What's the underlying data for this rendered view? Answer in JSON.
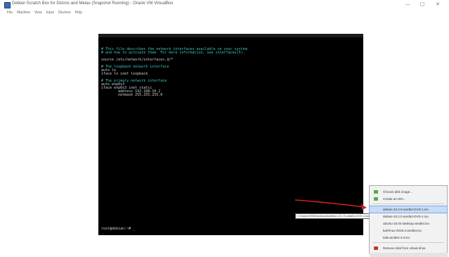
{
  "window": {
    "title": "Debian Scratch Box for Distros and Metas (Snapshot Running) - Oracle VM VirtualBox",
    "minimize": "—",
    "maximize": "□",
    "close": "✕"
  },
  "menu": [
    "File",
    "Machine",
    "View",
    "Input",
    "Devices",
    "Help"
  ],
  "vm": {
    "caption": "",
    "terminal_lines": [
      {
        "text": "# This file describes the network interfaces available on your system",
        "kind": "comment"
      },
      {
        "text": "# and how to activate them. For more information, see interfaces(5).",
        "kind": "comment"
      },
      {
        "text": "",
        "kind": "text"
      },
      {
        "text": "source /etc/network/interfaces.d/*",
        "kind": "text"
      },
      {
        "text": "",
        "kind": "text"
      },
      {
        "text": "# The loopback network interface",
        "kind": "comment"
      },
      {
        "text": "auto lo",
        "kind": "text"
      },
      {
        "text": "iface lo inet loopback",
        "kind": "text"
      },
      {
        "text": "",
        "kind": "text"
      },
      {
        "text": "# The primary network interface",
        "kind": "comment"
      },
      {
        "text": "auto enp0s3",
        "kind": "text"
      },
      {
        "text": "iface enp0s3 inet static",
        "kind": "text"
      },
      {
        "text": "        address 192.168.10.2",
        "kind": "text"
      },
      {
        "text": "        netmask 255.255.255.0",
        "kind": "text"
      }
    ],
    "prompt": "root@debian:~# _"
  },
  "tooltip": "C:\\Users\\VM\\Downloads\\debian-10.2.0-amd64-DVD-1.iso",
  "context_menu": {
    "items": [
      {
        "label": "Choose disk image...",
        "icon_color": "#5ea64a"
      },
      {
        "label": "Create an ISO...",
        "icon_color": "#5ea64a"
      },
      {
        "label": "debian-10.2.0-amd64-DVD-1.iso",
        "icon_color": "",
        "selected": true
      },
      {
        "label": "debian-10.2.0-amd64-DVD-1.iso",
        "icon_color": ""
      },
      {
        "label": "ubuntu-18.04-desktop-amd64.iso",
        "icon_color": ""
      },
      {
        "label": "kali-linux-2019.4-amd64.iso",
        "icon_color": ""
      },
      {
        "label": "tails-amd64-4.0.iso",
        "icon_color": ""
      },
      {
        "label": "Remove disk from virtual drive",
        "icon_color": "#c0392b"
      }
    ]
  },
  "colors": {
    "arrow": "#d42020"
  }
}
